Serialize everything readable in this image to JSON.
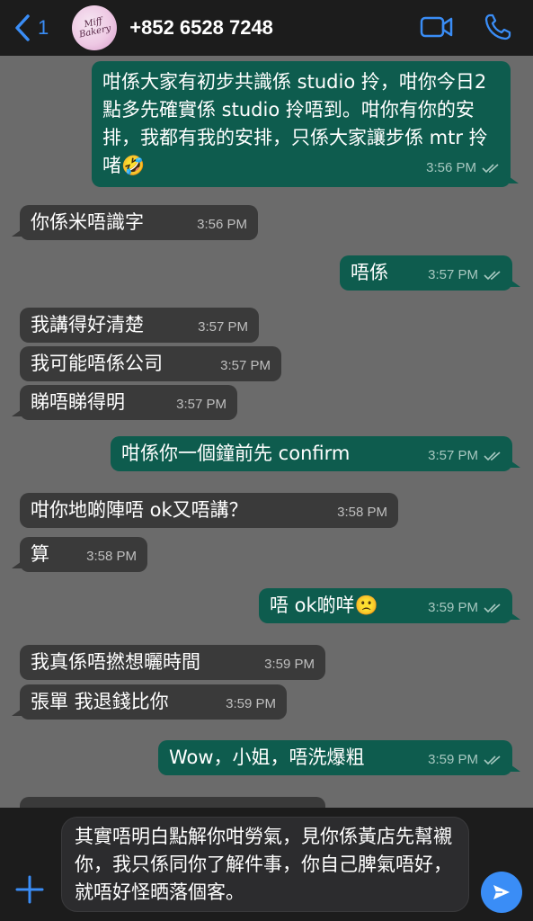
{
  "header": {
    "back_count": "1",
    "avatar_text": "Miff Bakery",
    "contact": "+852 6528 7248"
  },
  "messages": [
    {
      "dir": "out",
      "text": "咁係大家有初步共識係 studio 拎，咁你今日2點多先確實係 studio 拎唔到。咁你有你的安排，我都有我的安排，只係大家讓步係 mtr 拎啫🤣",
      "time": "3:56 PM"
    },
    {
      "dir": "in",
      "text": "你係米唔識字",
      "time": "3:56 PM"
    },
    {
      "dir": "out",
      "text": "唔係",
      "time": "3:57 PM"
    },
    {
      "dir": "in",
      "text": "我講得好清楚",
      "time": "3:57 PM"
    },
    {
      "dir": "in",
      "text": "我可能唔係公司",
      "time": "3:57 PM"
    },
    {
      "dir": "in",
      "text": "睇唔睇得明",
      "time": "3:57 PM"
    },
    {
      "dir": "out",
      "text": "咁係你一個鐘前先 confirm",
      "time": "3:57 PM"
    },
    {
      "dir": "in",
      "text": "咁你地啲陣唔 ok又唔講？",
      "time": "3:58 PM"
    },
    {
      "dir": "in",
      "text": "算",
      "time": "3:58 PM"
    },
    {
      "dir": "out",
      "text": "唔 ok啲咩🙁",
      "time": "3:59 PM"
    },
    {
      "dir": "in",
      "text": "我真係唔撚想曬時間",
      "time": "3:59 PM"
    },
    {
      "dir": "in",
      "text": "張單 我退錢比你",
      "time": "3:59 PM"
    },
    {
      "dir": "out",
      "text": "Wow，小姐，唔洗爆粗",
      "time": "3:59 PM"
    }
  ],
  "composer": {
    "text": "其實唔明白點解你咁勞氣，見你係黃店先幫襯你，我只係同你了解件事，你自己脾氣唔好，就唔好怪晒落個客。"
  },
  "icons": {
    "back": "chevron-left-icon",
    "video": "video-camera-icon",
    "call": "phone-icon",
    "attach": "plus-icon",
    "send": "send-icon",
    "read": "double-check-icon"
  },
  "colors": {
    "accent": "#3a8df6",
    "outgoing": "#0e5c4e",
    "incoming": "#3a3a3a",
    "background": "#6b6b6b"
  }
}
